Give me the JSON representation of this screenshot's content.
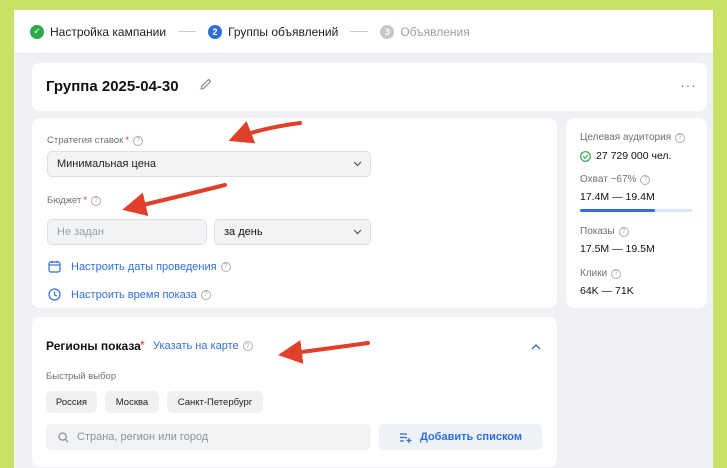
{
  "stepper": {
    "steps": [
      {
        "num": "✓",
        "label": "Настройка кампании"
      },
      {
        "num": "2",
        "label": "Группы объявлений"
      },
      {
        "num": "3",
        "label": "Объявления"
      }
    ]
  },
  "group": {
    "title": "Группа 2025-04-30",
    "more": "···"
  },
  "settings": {
    "bid_strategy_label": "Стратегия ставок",
    "bid_strategy_value": "Минимальная цена",
    "budget_label": "Бюджет",
    "budget_placeholder": "Не задан",
    "budget_period": "за день",
    "dates_link": "Настроить даты проведения",
    "time_link": "Настроить время показа"
  },
  "stats": {
    "audience_label": "Целевая аудитория",
    "audience_value": "27 729 000 чел.",
    "reach_label": "Охват ~67%",
    "reach_value": "17.4M — 19.4M",
    "reach_fraction": 0.67,
    "impressions_label": "Показы",
    "impressions_value": "17.5M — 19.5M",
    "clicks_label": "Клики",
    "clicks_value": "64K — 71K"
  },
  "regions": {
    "title": "Регионы показа",
    "map_link": "Указать на карте",
    "quick_label": "Быстрый выбор",
    "chips": [
      "Россия",
      "Москва",
      "Санкт-Петербург"
    ],
    "search_placeholder": "Страна, регион или город",
    "add_list": "Добавить списком"
  },
  "colors": {
    "accent": "#2f6fdb",
    "success": "#2ea84a",
    "required": "#e0341f",
    "annotation": "#e0402a",
    "background": "#c9e265"
  }
}
